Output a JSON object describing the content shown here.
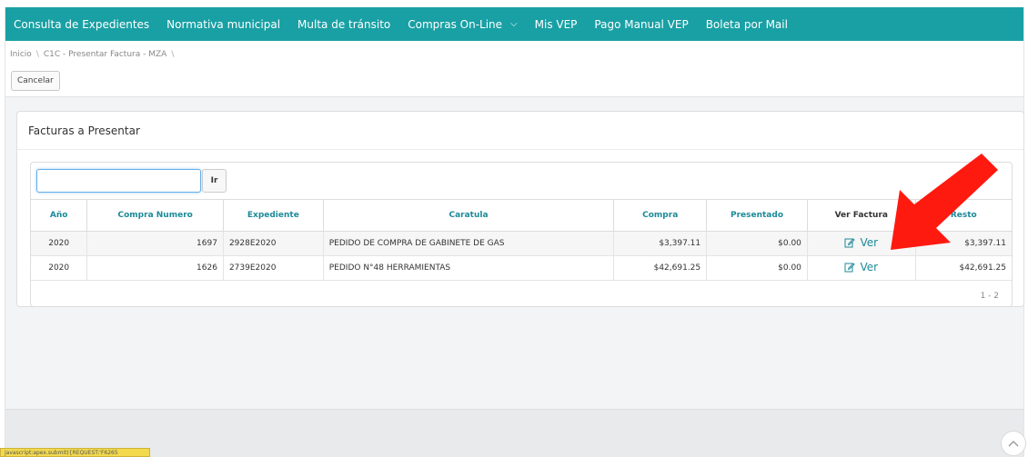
{
  "nav": {
    "items": [
      {
        "label": "Consulta de Expedientes",
        "has_caret": false
      },
      {
        "label": "Normativa municipal",
        "has_caret": false
      },
      {
        "label": "Multa de tránsito",
        "has_caret": false
      },
      {
        "label": "Compras On-Line",
        "has_caret": true
      },
      {
        "label": "Mis VEP",
        "has_caret": false
      },
      {
        "label": "Pago Manual VEP",
        "has_caret": false
      },
      {
        "label": "Boleta por Mail",
        "has_caret": false
      }
    ],
    "accent_color": "#19a0a4"
  },
  "breadcrumb": {
    "home": "Inicio",
    "current": "C1C - Presentar Factura - MZA",
    "separator": "\\"
  },
  "actions": {
    "cancel_label": "Cancelar"
  },
  "card": {
    "title": "Facturas a Presentar"
  },
  "search": {
    "value": "",
    "go_label": "Ir"
  },
  "table": {
    "columns": [
      "Año",
      "Compra Numero",
      "Expediente",
      "Caratula",
      "Compra",
      "Presentado",
      "Ver Factura",
      "Resto"
    ],
    "rows": [
      {
        "anio": "2020",
        "compra_numero": "1697",
        "expediente": "2928E2020",
        "caratula": "PEDIDO DE COMPRA DE GABINETE DE GAS",
        "compra": "$3,397.11",
        "presentado": "$0.00",
        "ver": "Ver",
        "resto": "$3,397.11"
      },
      {
        "anio": "2020",
        "compra_numero": "1626",
        "expediente": "2739E2020",
        "caratula": "PEDIDO N°48 HERRAMIENTAS",
        "compra": "$42,691.25",
        "presentado": "$0.00",
        "ver": "Ver",
        "resto": "$42,691.25"
      }
    ],
    "pagination": "1 - 2"
  },
  "annotation": {
    "arrow_color": "#ff0000"
  },
  "status_bar": {
    "url": "javascript:apex.submit({REQUEST:'F6265"
  }
}
